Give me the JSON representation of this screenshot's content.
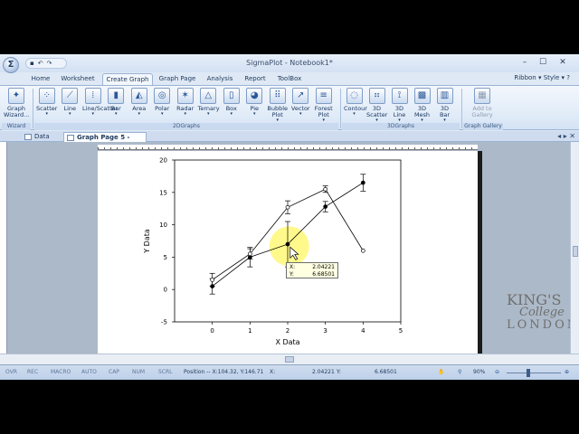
{
  "window": {
    "title": "SigmaPlot - Notebook1*",
    "orb_label": "Σ",
    "controls": {
      "minimize": "–",
      "maximize": "☐",
      "close": "✕"
    }
  },
  "ribbon_tabs": [
    "Home",
    "Worksheet",
    "Create Graph",
    "Graph Page",
    "Analysis",
    "Report",
    "ToolBox"
  ],
  "active_tab": "Create Graph",
  "ribbon_right": {
    "ribbon": "Ribbon",
    "style": "Style"
  },
  "ribbon": {
    "wizard": {
      "label1": "Graph",
      "label2": "Wizard...",
      "group": "Wizard"
    },
    "graphs2d": [
      {
        "l1": "Scatter",
        "l2": "",
        "icon": "scatter-icon"
      },
      {
        "l1": "Line",
        "l2": "",
        "icon": "line-icon"
      },
      {
        "l1": "Line/Scatter",
        "l2": "",
        "icon": "line-scatter-icon"
      },
      {
        "l1": "Bar",
        "l2": "",
        "icon": "bar-icon"
      },
      {
        "l1": "Area",
        "l2": "",
        "icon": "area-icon"
      },
      {
        "l1": "Polar",
        "l2": "",
        "icon": "polar-icon"
      },
      {
        "l1": "Radar",
        "l2": "",
        "icon": "radar-icon"
      },
      {
        "l1": "Ternary",
        "l2": "",
        "icon": "ternary-icon"
      },
      {
        "l1": "Box",
        "l2": "",
        "icon": "box-icon"
      },
      {
        "l1": "Pie",
        "l2": "",
        "icon": "pie-icon"
      },
      {
        "l1": "Bubble",
        "l2": "Plot",
        "icon": "bubble-icon"
      },
      {
        "l1": "Vector",
        "l2": "",
        "icon": "vector-icon"
      },
      {
        "l1": "Forest",
        "l2": "Plot",
        "icon": "forest-icon"
      }
    ],
    "group_2d": "2DGraphs",
    "graphs3d": [
      {
        "l1": "Contour",
        "l2": "",
        "icon": "contour-icon"
      },
      {
        "l1": "3D",
        "l2": "Scatter",
        "icon": "scatter3d-icon"
      },
      {
        "l1": "3D",
        "l2": "Line",
        "icon": "line3d-icon"
      },
      {
        "l1": "3D",
        "l2": "Mesh",
        "icon": "mesh3d-icon"
      },
      {
        "l1": "3D",
        "l2": "Bar",
        "icon": "bar3d-icon"
      }
    ],
    "group_3d": "3DGraphs",
    "gallery": {
      "l1": "Add to",
      "l2": "Gallery",
      "group": "Graph Gallery"
    }
  },
  "doc_tabs": [
    "Data 1*",
    "Graph Page 5 - Data 1*"
  ],
  "active_doc_tab": "Graph Page 5 - Data 1*",
  "chart_data": {
    "type": "line",
    "xlabel": "X Data",
    "ylabel": "Y Data",
    "xlim": [
      -1,
      5
    ],
    "ylim": [
      -5,
      20
    ],
    "xticks": [
      "0",
      "1",
      "2",
      "3",
      "4",
      "5"
    ],
    "yticks": [
      "-5",
      "0",
      "5",
      "10",
      "15",
      "20"
    ],
    "series": [
      {
        "marker": "filled-circle",
        "x": [
          0,
          1,
          2,
          3,
          4
        ],
        "y": [
          0.5,
          5,
          7,
          12.8,
          16.5
        ],
        "err": [
          1.2,
          1.5,
          3.5,
          0.8,
          1.3
        ]
      },
      {
        "marker": "open-circle",
        "x": [
          0,
          1,
          2,
          3,
          4
        ],
        "y": [
          1.5,
          5.5,
          12.7,
          15.5,
          6
        ],
        "err": [
          1.0,
          0.8,
          1.0,
          0.5,
          0
        ]
      }
    ],
    "highlight": {
      "x": 2.04221,
      "y": 6.68501
    }
  },
  "tooltip": {
    "x_label": "X:",
    "x_value": "2.04221",
    "y_label": "Y:",
    "y_value": "6.68501"
  },
  "watermark": {
    "line1": "KING'S",
    "line2": "College",
    "line3": "LONDON"
  },
  "status": {
    "ovr": "OVR",
    "rec": "REC",
    "macro": "MACRO",
    "auto": "AUTO",
    "cap": "CAP",
    "num": "NUM",
    "scrl": "SCRL",
    "position": "Position -- X:104.32, Y:146.71",
    "x_label": "X:",
    "x_value": "2.04221",
    "y_label": "Y:",
    "y_value": "6.68501",
    "zoom": "90%"
  }
}
